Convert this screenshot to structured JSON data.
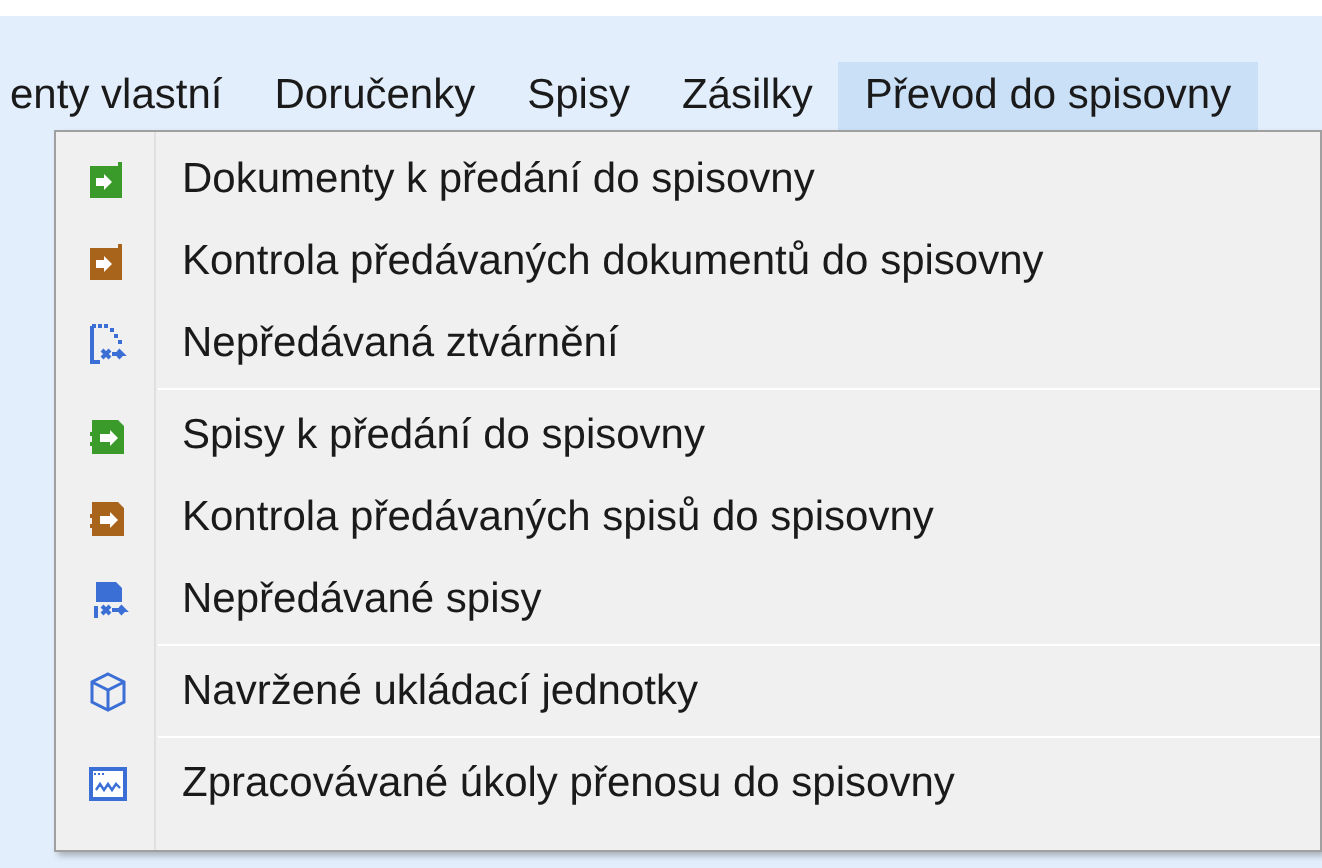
{
  "menubar": [
    {
      "label": "enty vlastní",
      "selected": false
    },
    {
      "label": "Doručenky",
      "selected": false
    },
    {
      "label": "Spisy",
      "selected": false
    },
    {
      "label": "Zásilky",
      "selected": false
    },
    {
      "label": "Převod do spisovny",
      "selected": true
    }
  ],
  "menu": {
    "groups": [
      [
        {
          "label": "Dokumenty k předání do spisovny",
          "kind": "document",
          "color": "#3a9a2a"
        },
        {
          "label": "Kontrola předávaných dokumentů do spisovny",
          "kind": "document",
          "color": "#a8641a"
        },
        {
          "label": "Nepředávaná ztvárnění",
          "kind": "document-excluded",
          "color": "#3b6fd6"
        }
      ],
      [
        {
          "label": "Spisy k předání do spisovny",
          "kind": "file",
          "color": "#3a9a2a"
        },
        {
          "label": "Kontrola předávaných spisů do spisovny",
          "kind": "file",
          "color": "#a8641a"
        },
        {
          "label": "Nepředávané spisy",
          "kind": "file-excluded",
          "color": "#3b6fd6"
        }
      ],
      [
        {
          "label": "Navržené ukládací jednotky",
          "kind": "cube",
          "color": "#3b6fd6"
        }
      ],
      [
        {
          "label": "Zpracovávané úkoly přenosu do spisovny",
          "kind": "chart",
          "color": "#3b6fd6"
        }
      ]
    ]
  }
}
